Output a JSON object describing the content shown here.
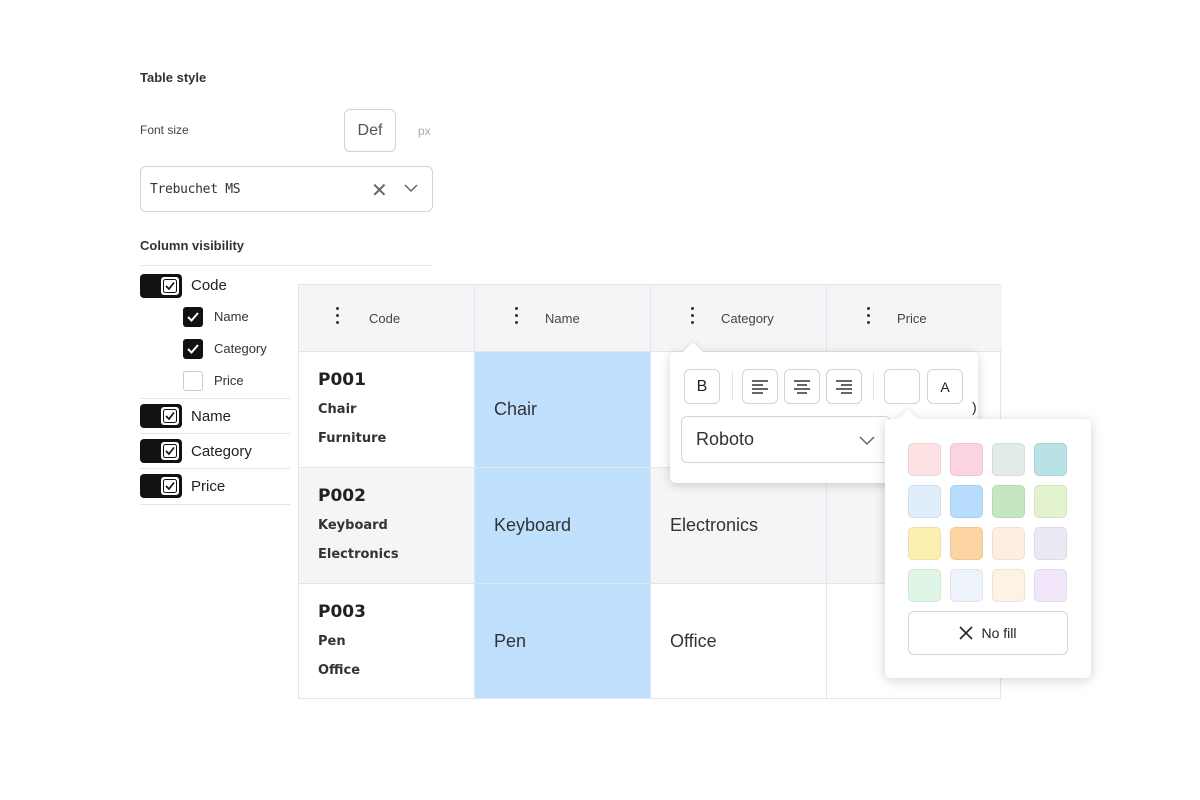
{
  "settings": {
    "title": "Table style",
    "font_size_label": "Font size",
    "font_size_value": "Def",
    "font_size_unit": "px",
    "font_family": "Trebuchet MS",
    "column_visibility_label": "Column visibility",
    "columns": [
      {
        "label": "Code",
        "checked": true,
        "sub": [
          {
            "label": "Name",
            "checked": true
          },
          {
            "label": "Category",
            "checked": true
          },
          {
            "label": "Price",
            "checked": false
          }
        ]
      },
      {
        "label": "Name",
        "checked": true
      },
      {
        "label": "Category",
        "checked": true
      },
      {
        "label": "Price",
        "checked": true
      }
    ]
  },
  "table": {
    "headers": [
      "Code",
      "Name",
      "Category",
      "Price"
    ],
    "rows": [
      {
        "code": "P001",
        "name_sub": "Chair",
        "category_sub": "Furniture",
        "name": "Chair",
        "category": "",
        "price": ""
      },
      {
        "code": "P002",
        "name_sub": "Keyboard",
        "category_sub": "Electronics",
        "name": "Keyboard",
        "category": "Electronics",
        "price": ""
      },
      {
        "code": "P003",
        "name_sub": "Pen",
        "category_sub": "Office",
        "name": "Pen",
        "category": "Office",
        "price": ""
      }
    ]
  },
  "format_popup": {
    "bold": "B",
    "text_color_button": "A",
    "font": "Roboto",
    "clipped_text": ")"
  },
  "color_popup": {
    "swatches": [
      "#fde2e4",
      "#fbd3e3",
      "#e2ebe8",
      "#b9e2e6",
      "#e0edfb",
      "#b8dcfd",
      "#c5e7bf",
      "#e3f2cf",
      "#fdefb2",
      "#fdd5a3",
      "#fdeee1",
      "#ece8f4",
      "#dff6e6",
      "#eef2fb",
      "#fdf2e3",
      "#f2e6fb"
    ],
    "no_fill": "No fill"
  },
  "colors": {
    "highlight": "#bfe0fd",
    "toggle": "#111111"
  }
}
